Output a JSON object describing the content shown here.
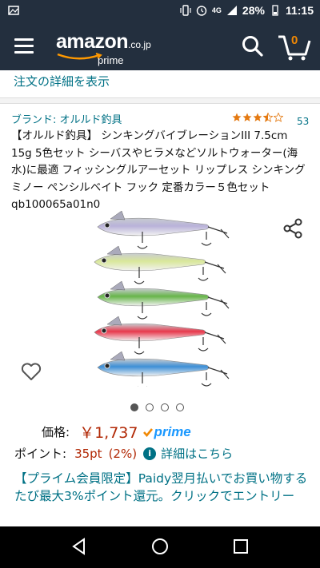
{
  "status": {
    "network": "4G",
    "battery": "28%",
    "time": "11:15"
  },
  "header": {
    "logo_word": "amazon",
    "logo_tld": ".co.jp",
    "logo_prime": "prime",
    "cart_count": "0",
    "icons": [
      "menu-icon",
      "search-icon",
      "cart-icon"
    ]
  },
  "order_link": "注文の詳細を表示",
  "product": {
    "brand": "ブランド: オルルド釣具",
    "rating": 3.5,
    "rating_count": "53",
    "title": "【オルルド釣具】 シンキングバイブレーションIII 7.5cm 15g 5色セット シーバスやヒラメなどソルトウォーター(海水)に最適 フィッシングルアーセット リップレス シンキングミノー ペンシルベイト フック 定番カラー５色セット qb100065a01n0",
    "image_count": 4,
    "active_image": 1,
    "lure_colors": [
      "#b9b2d9",
      "#d9e79a",
      "#67b54a",
      "#e8394c",
      "#3d8fd6"
    ]
  },
  "price": {
    "label": "価格:",
    "value": "￥1,737",
    "prime_label": "prime"
  },
  "points": {
    "label": "ポイント:",
    "value": "35pt",
    "percent": "(2%)",
    "link": "詳細はこちら"
  },
  "promo": "【プライム会員限定】Paidy翌月払いでお買い物するたび最大3%ポイント還元。クリックでエントリー",
  "colors": {
    "header_bg": "#232f3e",
    "link": "#007185",
    "price": "#b12704",
    "prime": "#1a98ff",
    "star": "#e47911"
  }
}
